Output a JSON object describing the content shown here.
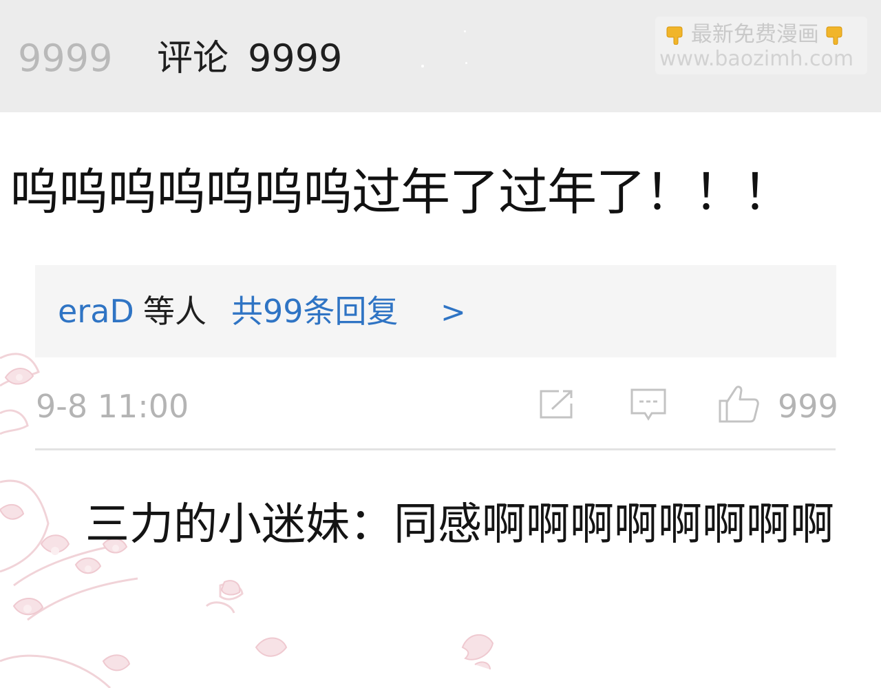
{
  "header": {
    "left_count": "9999",
    "comment_label": "评论",
    "comment_count": "9999"
  },
  "watermark": {
    "line1": "最新免费漫画",
    "line2": "www.baozimh.com"
  },
  "comment": {
    "text": "呜呜呜呜呜呜呜过年了过年了！！！"
  },
  "replies": {
    "user": "eraD",
    "etc": "等人",
    "total": "共99条回复",
    "arrow": ">"
  },
  "meta": {
    "timestamp": "9-8 11:00",
    "like_count": "999"
  },
  "sub_reply": {
    "text": "三力的小迷妹：同感啊啊啊啊啊啊啊啊"
  },
  "icons": {
    "share": "share-icon",
    "comment": "comment-icon",
    "like": "thumbs-up-icon",
    "hand": "pointing-down-hand-icon",
    "decor": "cherry-blossom-decoration"
  },
  "colors": {
    "header_bg": "#ececec",
    "link_blue": "#2f74c4",
    "muted_gray": "#b4b4b4",
    "text_dark": "#111111",
    "reply_bg": "#f5f5f5"
  }
}
